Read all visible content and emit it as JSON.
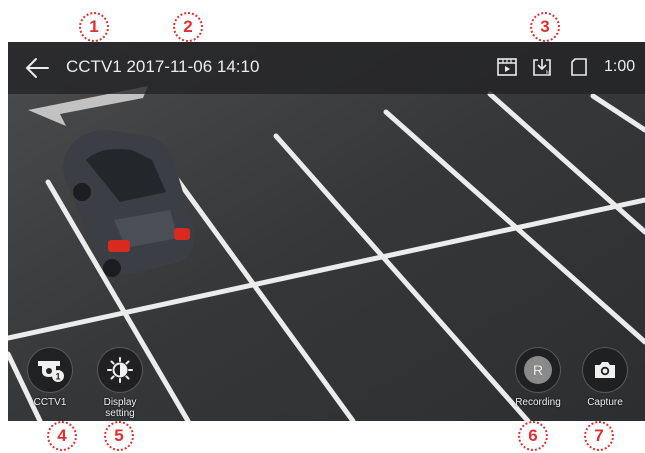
{
  "header": {
    "camera_name": "CCTV1",
    "datetime": "2017-11-06 14:10",
    "battery_text": "1:00"
  },
  "callouts": [
    "1",
    "2",
    "3",
    "4",
    "5",
    "6",
    "7"
  ],
  "controls": {
    "cctv": {
      "label": "CCTV1",
      "badge": "1"
    },
    "display": {
      "label_line1": "Display",
      "label_line2": "setting"
    },
    "recording": {
      "label": "Recording",
      "glyph": "R"
    },
    "capture": {
      "label": "Capture"
    }
  },
  "icons": {
    "back": "arrow-left-icon",
    "playback": "film-play-icon",
    "download": "download-box-icon",
    "sdcard": "sd-card-icon",
    "cctv": "cctv-camera-icon",
    "display": "brightness-contrast-icon",
    "capture": "camera-icon"
  },
  "colors": {
    "callout": "#e03030",
    "topbar": "#222325",
    "car": "#3b3e44",
    "taillight": "#d82a1e",
    "lane_line": "#eeeeee"
  }
}
